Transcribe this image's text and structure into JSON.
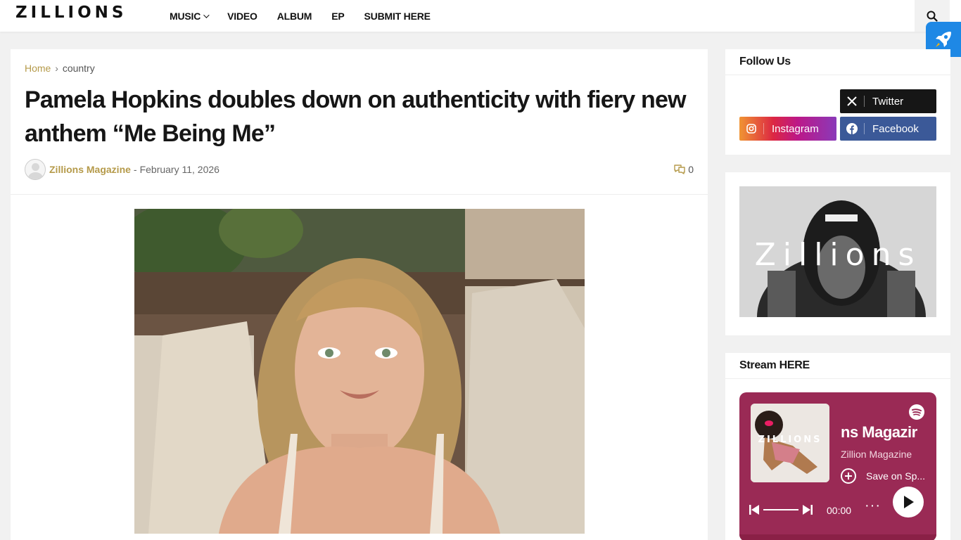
{
  "header": {
    "logo": "ZILLIONS",
    "nav": [
      "MUSIC",
      "VIDEO",
      "ALBUM",
      "EP",
      "SUBMIT HERE"
    ],
    "icons": {
      "search": "search-icon",
      "rocket": "rocket-icon"
    },
    "colors": {
      "accent": "#1e88e5"
    }
  },
  "breadcrumb": {
    "home": "Home",
    "separator": "›",
    "category": "country"
  },
  "article": {
    "title": "Pamela Hopkins doubles down on authenticity with fiery new anthem “Me Being Me”",
    "author": "Zillions Magazine",
    "dash": "-",
    "date": "February 11, 2026",
    "comment_count": "0",
    "colors": {
      "author": "#b59a4a"
    }
  },
  "sidebar": {
    "follow": {
      "title": "Follow Us",
      "twitter": "Twitter",
      "instagram": "Instagram",
      "facebook": "Facebook",
      "colors": {
        "twitter": "#161616",
        "facebook": "#3b5998"
      }
    },
    "banner": {
      "text": "Zillions"
    },
    "stream": {
      "title": "Stream HERE",
      "album_text": "ZILLIONS",
      "track_title": "ns Magazir",
      "artist": "Zillion Magazine",
      "save_label": "Save on Sp...",
      "time": "00:00",
      "more": "···",
      "colors": {
        "card": "#9a2a55"
      }
    }
  }
}
